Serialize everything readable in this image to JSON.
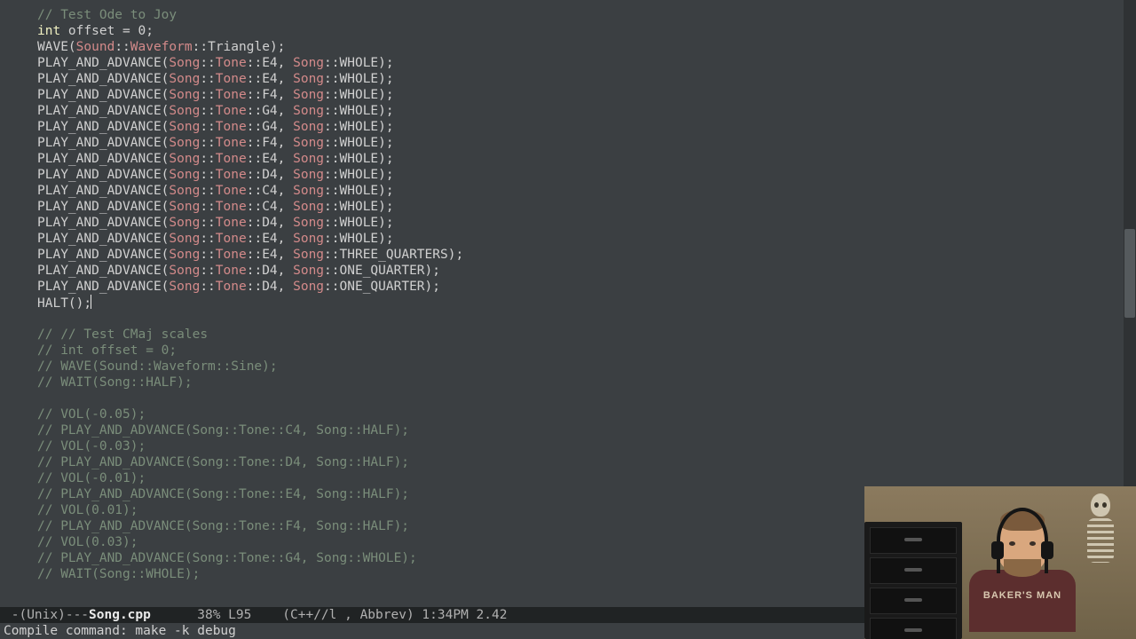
{
  "code": {
    "indent": "    ",
    "comment_ode": "// Test Ode to Joy",
    "int": "int",
    "offset_decl": " offset = ",
    "zero": "0",
    "semi": ";",
    "wave_macro": "WAVE",
    "sound_ns": "Sound",
    "waveform": "Waveform",
    "triangle": "Triangle",
    "play_macro": "PLAY_AND_ADVANCE",
    "song_ns": "Song",
    "tone": "Tone",
    "whole": "WHOLE",
    "three_q": "THREE_QUARTERS",
    "one_q": "ONE_QUARTER",
    "halt": "HALT",
    "notes": [
      {
        "n": "E4",
        "d": "WHOLE"
      },
      {
        "n": "E4",
        "d": "WHOLE"
      },
      {
        "n": "F4",
        "d": "WHOLE"
      },
      {
        "n": "G4",
        "d": "WHOLE"
      },
      {
        "n": "G4",
        "d": "WHOLE"
      },
      {
        "n": "F4",
        "d": "WHOLE"
      },
      {
        "n": "E4",
        "d": "WHOLE"
      },
      {
        "n": "D4",
        "d": "WHOLE"
      },
      {
        "n": "C4",
        "d": "WHOLE"
      },
      {
        "n": "C4",
        "d": "WHOLE"
      },
      {
        "n": "D4",
        "d": "WHOLE"
      },
      {
        "n": "E4",
        "d": "WHOLE"
      },
      {
        "n": "E4",
        "d": "THREE_QUARTERS"
      },
      {
        "n": "D4",
        "d": "ONE_QUARTER"
      },
      {
        "n": "D4",
        "d": "ONE_QUARTER"
      }
    ],
    "commented_block": [
      "// // Test CMaj scales",
      "// int offset = 0;",
      "// WAVE(Sound::Waveform::Sine);",
      "// WAIT(Song::HALF);",
      "",
      "// VOL(-0.05);",
      "// PLAY_AND_ADVANCE(Song::Tone::C4, Song::HALF);",
      "// VOL(-0.03);",
      "// PLAY_AND_ADVANCE(Song::Tone::D4, Song::HALF);",
      "// VOL(-0.01);",
      "// PLAY_AND_ADVANCE(Song::Tone::E4, Song::HALF);",
      "// VOL(0.01);",
      "// PLAY_AND_ADVANCE(Song::Tone::F4, Song::HALF);",
      "// VOL(0.03);",
      "// PLAY_AND_ADVANCE(Song::Tone::G4, Song::WHOLE);",
      "// WAIT(Song::WHOLE);"
    ]
  },
  "modeline": {
    "left": " -(Unix)---",
    "filename": "Song.cpp",
    "mid": "      38% L95    (C++//l , Abbrev) 1:34PM 2.42"
  },
  "minibuffer": {
    "prompt": "Compile command: ",
    "cmd": "make -k debug"
  },
  "webcam": {
    "shirt": "BAKER'S\nMAN"
  }
}
